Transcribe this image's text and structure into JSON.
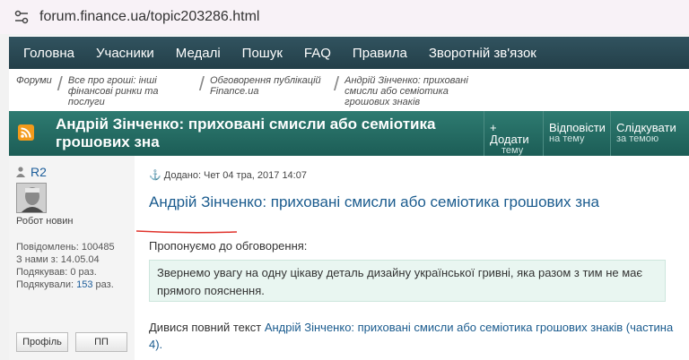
{
  "browser": {
    "url": "forum.finance.ua/topic203286.html"
  },
  "nav": {
    "items": [
      "Головна",
      "Учасники",
      "Медалі",
      "Пошук",
      "FAQ",
      "Правила",
      "Зворотній зв'язок"
    ]
  },
  "breadcrumbs": [
    "Форуми",
    "Все про гроші: інші фінансові ринки та послуги",
    "Обговорення публікацій Finance.ua",
    "Андрій Зінченко: приховані смисли або семіотика грошових знаків"
  ],
  "topic": {
    "title": "Андрій Зінченко: приховані смисли або семіотика грошових зна",
    "buttons": [
      {
        "main": "+ Додати",
        "sub": "тему"
      },
      {
        "main": "Відповісти",
        "sub": "на тему"
      },
      {
        "main": "Слідкувати",
        "sub": "за темою"
      }
    ]
  },
  "user": {
    "name": "R2",
    "rank": "Робот новин",
    "stats": {
      "posts": "Повідомлень: 100485",
      "joined": "З нами з: 14.05.04",
      "thanked": "Подякував: 0 раз.",
      "thanked_by_label": "Подякували:",
      "thanked_by_count": "153",
      "thanked_by_suffix": " раз."
    },
    "profile_button": "Профіль",
    "pm_button": "ПП"
  },
  "post": {
    "date": "Додано: Чет 04 тра, 2017 14:07",
    "title": "Андрій Зінченко: приховані смисли або семіотика грошових зна",
    "intro": "Пропонуємо до обговорення:",
    "quote": "Звернемо увагу на одну цікаву деталь дизайну української гривні, яка разом з тим не має прямого пояснення.",
    "more_prefix": "Дивися повний текст ",
    "more_link": "Андрій Зінченко: приховані смисли або семіотика грошових знаків (частина 4).",
    "accent_underline_color": "#e0322b"
  }
}
